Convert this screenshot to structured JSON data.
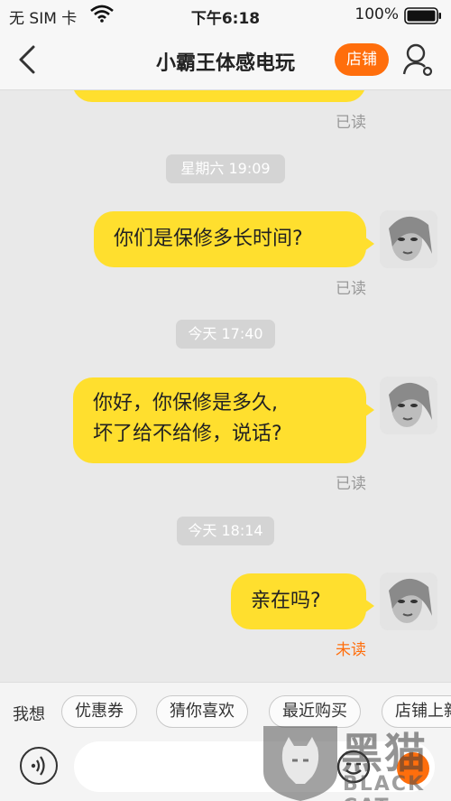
{
  "status_bar": {
    "carrier": "无 SIM 卡",
    "time": "下午6:18",
    "battery_pct": "100%"
  },
  "nav": {
    "title": "小霸王体感电玩",
    "shop_label": "店铺"
  },
  "messages": [
    {
      "status": "已读"
    },
    {
      "time": "星期六 19:09",
      "lines": [
        "你们是保修多长时间?"
      ],
      "status": "已读"
    },
    {
      "time": "今天 17:40",
      "lines": [
        "你好，你保修是多久,",
        "坏了给不给修，说话?"
      ],
      "status": "已读"
    },
    {
      "time": "今天 18:14",
      "lines": [
        "亲在吗?"
      ],
      "status": "未读"
    }
  ],
  "quick_reply": {
    "label": "我想",
    "chips": [
      "优惠券",
      "猜你喜欢",
      "最近购买",
      "店铺上新"
    ]
  },
  "input": {
    "placeholder": ""
  },
  "watermark": {
    "cn": "黑猫",
    "en": "BLACK CAT"
  },
  "colors": {
    "accent": "#ff6e0c",
    "bubble": "#ffdf2e",
    "background": "#e9e9e9"
  }
}
